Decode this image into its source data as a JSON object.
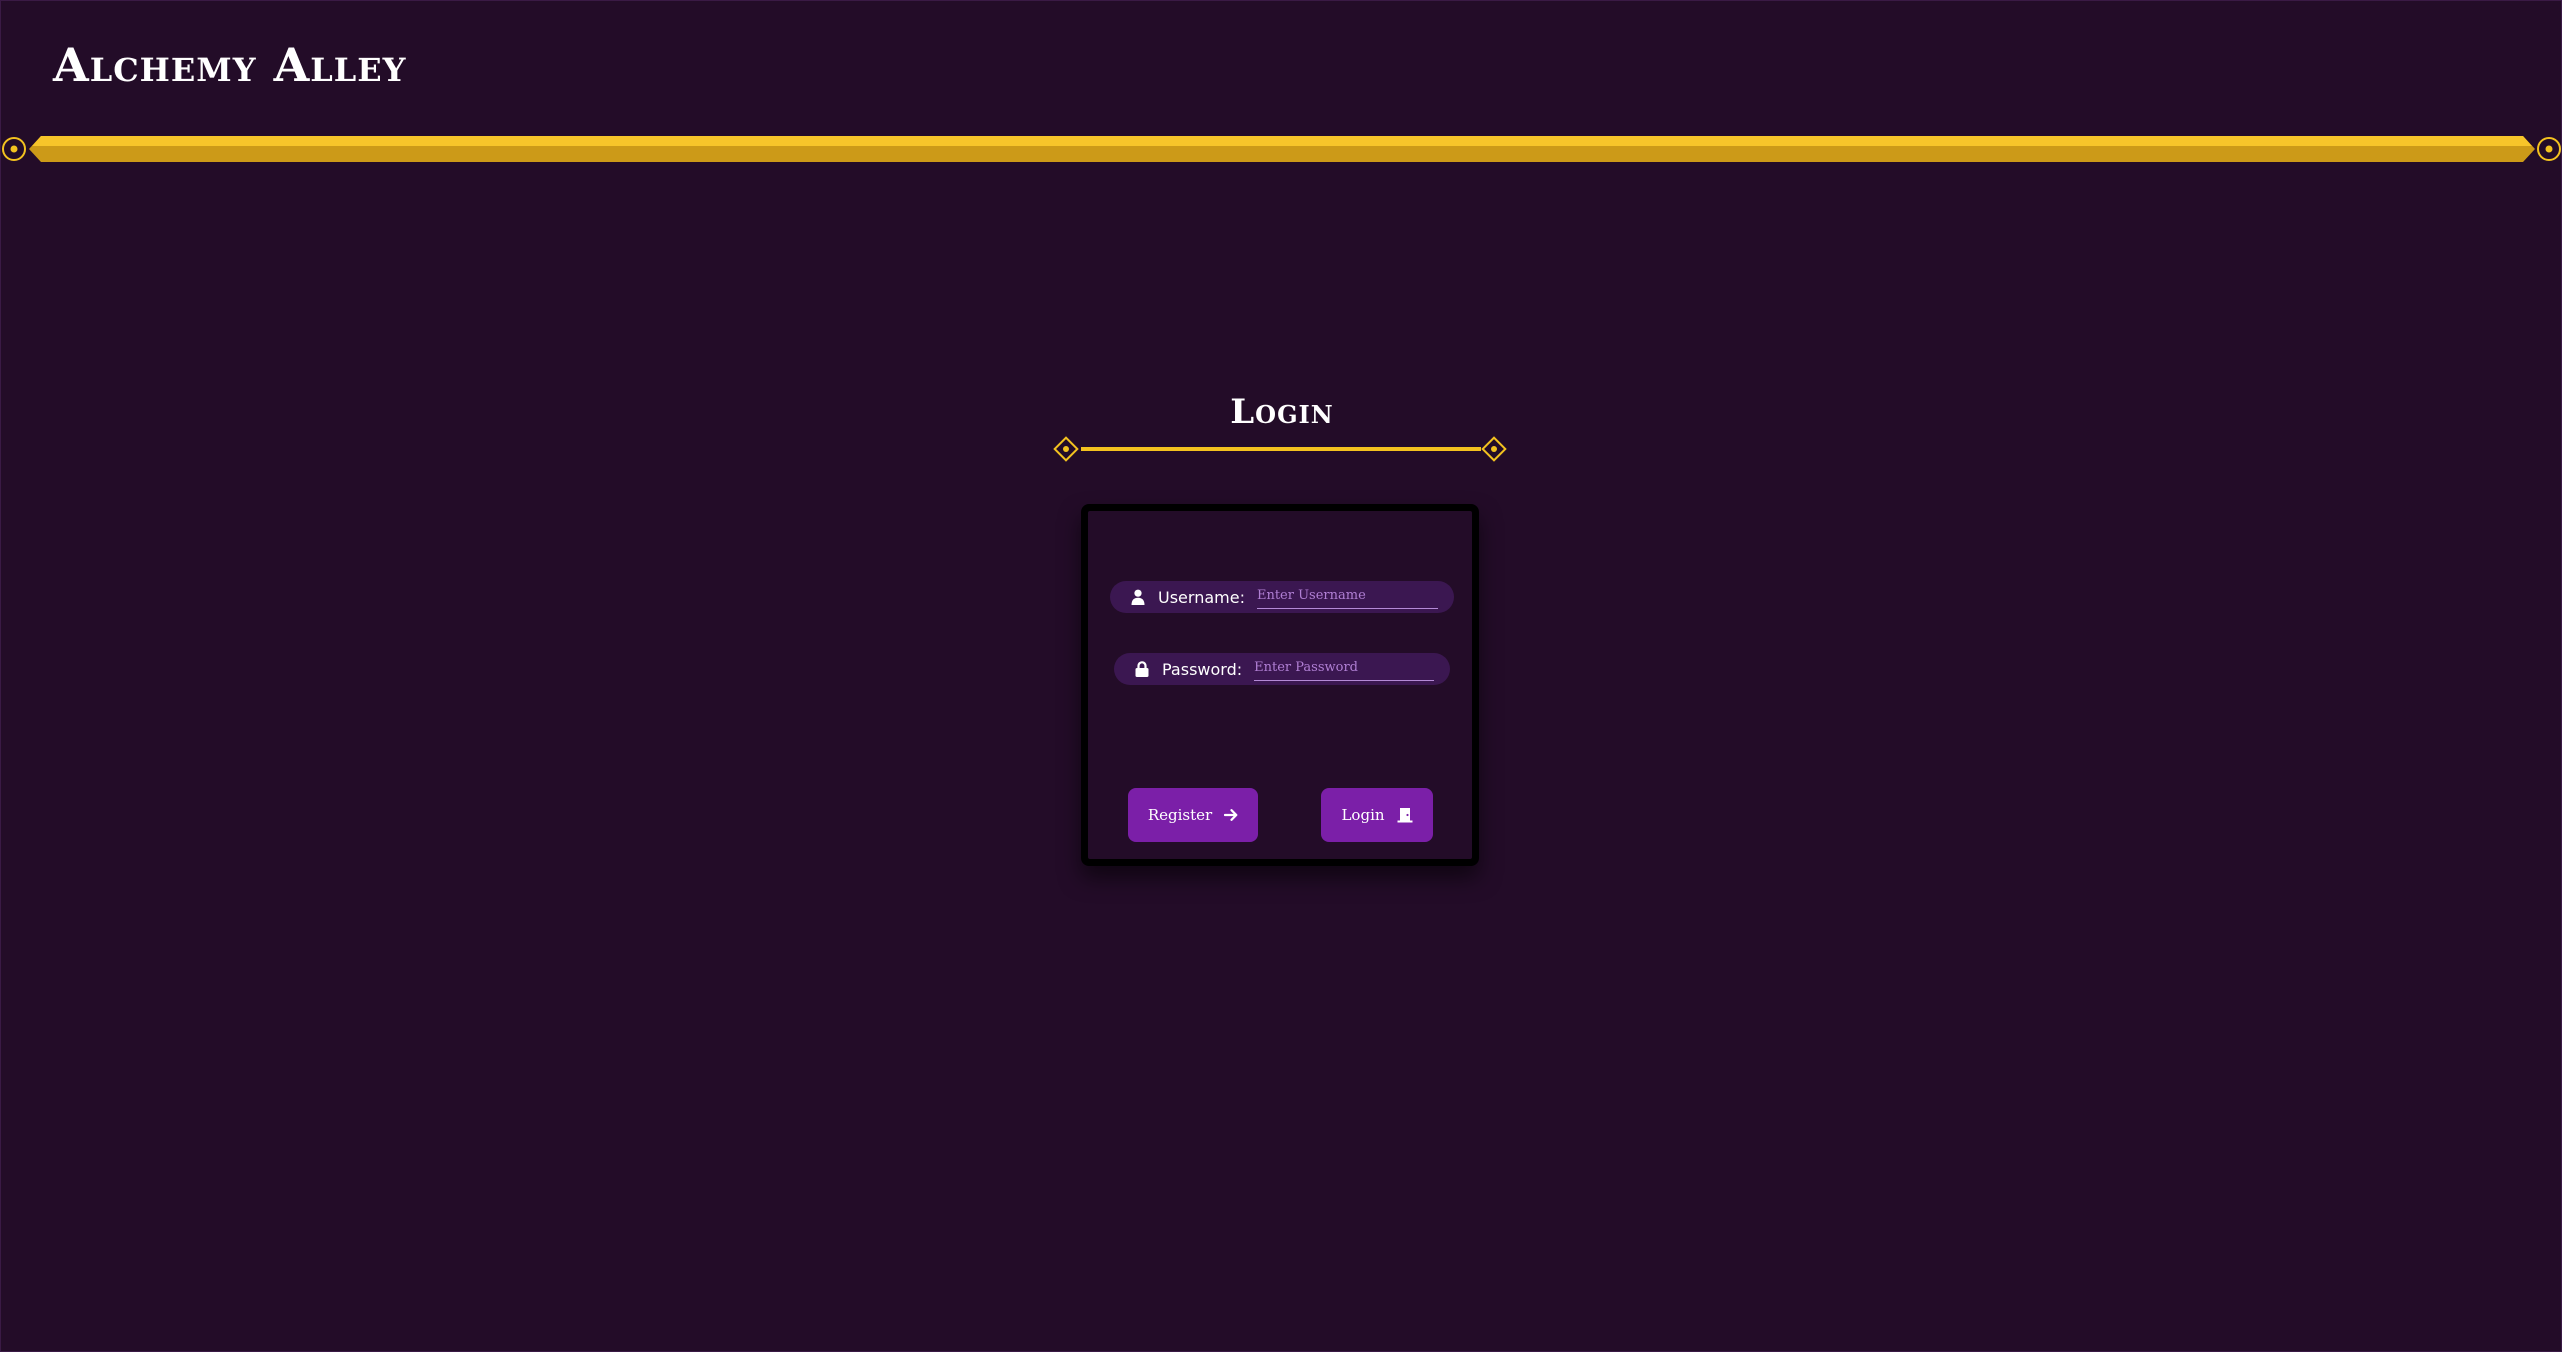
{
  "app": {
    "title": "Alchemy Alley"
  },
  "login": {
    "heading": "Login",
    "username": {
      "label": "Username:",
      "placeholder": "Enter Username",
      "value": "",
      "icon": "user-icon"
    },
    "password": {
      "label": "Password:",
      "placeholder": "Enter Password",
      "value": "",
      "icon": "lock-icon"
    },
    "buttons": {
      "register_label": "Register",
      "register_icon": "arrow-right-icon",
      "login_label": "Login",
      "login_icon": "door-icon"
    }
  },
  "colors": {
    "background": "#230c28",
    "gold": "#f3c21f",
    "button": "#7b1fa8",
    "field": "#3b1751",
    "card": "#000000"
  }
}
